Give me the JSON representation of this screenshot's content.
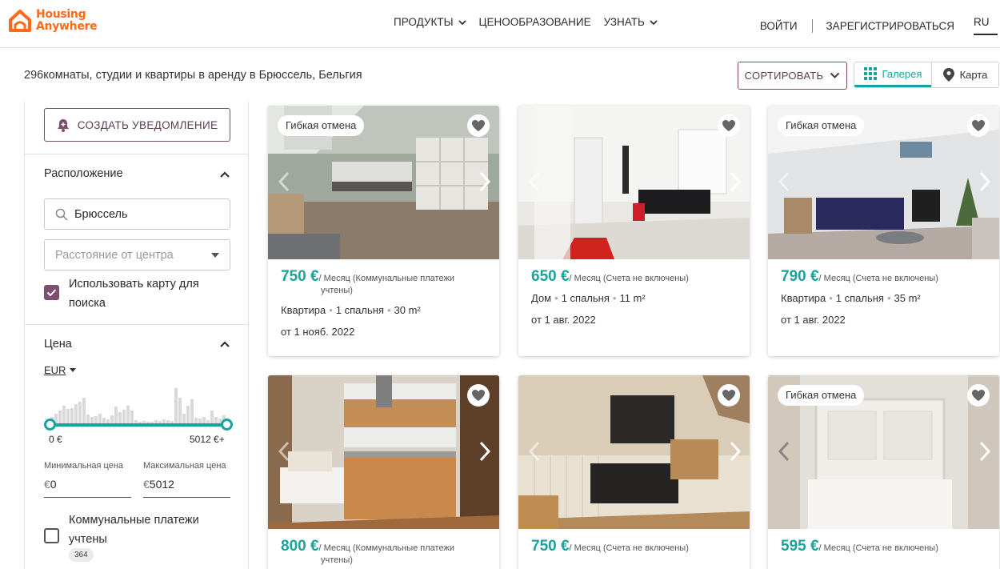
{
  "header": {
    "logo_line1": "Housing",
    "logo_line2": "Anywhere",
    "nav": [
      "ПРОДУКТЫ",
      "ЦЕНООБРАЗОВАНИЕ",
      "УЗНАТЬ"
    ],
    "login": "ВОЙТИ",
    "register": "ЗАРЕГИСТРИРОВАТЬСЯ",
    "lang": "RU"
  },
  "results": {
    "title": "296комнаты, студии и квартиры в аренду в Брюссель, Бельгия",
    "sort_label": "СОРТИРОВАТЬ",
    "view_gallery": "Галерея",
    "view_map": "Карта"
  },
  "sidebar": {
    "alert_button": "СОЗДАТЬ УВЕДОМЛЕНИЕ",
    "location": {
      "title": "Расположение",
      "search_value": "Брюссель",
      "distance_placeholder": "Расстояние от центра",
      "use_map_line1": "Использовать карту для",
      "use_map_line2": "поиска",
      "use_map_checked": true
    },
    "price": {
      "title": "Цена",
      "currency": "EUR",
      "min_label": "0 €",
      "max_label": "5012 €+",
      "min_field_label": "Минимальная цена",
      "max_field_label": "Максимальная цена",
      "min_currency": "€",
      "min_value": "0",
      "max_currency": "€",
      "max_value": "5012",
      "utilities_line1": "Коммунальные платежи",
      "utilities_line2": "учтены",
      "utilities_count": "364",
      "utilities_checked": false
    }
  },
  "colors": {
    "accent": "#1aa29c",
    "brand": "#ff6a1a",
    "secondary": "#7d4f6f"
  },
  "listings": [
    {
      "badge": "Гибкая отмена",
      "price": "750 €",
      "unit_line1": "/ Месяц (Коммунальные платежи",
      "unit_line2": "учтены)",
      "type": "Квартира",
      "bedrooms": "1 спальня",
      "size": "30 m²",
      "available": "от 1 нояб. 2022"
    },
    {
      "badge": "",
      "price": "650 €",
      "unit_line1": "/ Месяц (Счета не включены)",
      "unit_line2": "",
      "type": "Дом",
      "bedrooms": "1 спальня",
      "size": "11 m²",
      "available": "от 1 авг. 2022"
    },
    {
      "badge": "Гибкая отмена",
      "price": "790 €",
      "unit_line1": "/ Месяц (Счета не включены)",
      "unit_line2": "",
      "type": "Квартира",
      "bedrooms": "1 спальня",
      "size": "35 m²",
      "available": "от 1 авг. 2022"
    },
    {
      "badge": "",
      "price": "800 €",
      "unit_line1": "/ Месяц (Коммунальные платежи",
      "unit_line2": "учтены)",
      "type": "",
      "bedrooms": "",
      "size": "",
      "available": ""
    },
    {
      "badge": "",
      "price": "750 €",
      "unit_line1": "/ Месяц (Счета не включены)",
      "unit_line2": "",
      "type": "",
      "bedrooms": "",
      "size": "",
      "available": ""
    },
    {
      "badge": "Гибкая отмена",
      "price": "595 €",
      "unit_line1": "/ Месяц (Счета не включены)",
      "unit_line2": "",
      "type": "",
      "bedrooms": "",
      "size": "",
      "available": ""
    }
  ]
}
